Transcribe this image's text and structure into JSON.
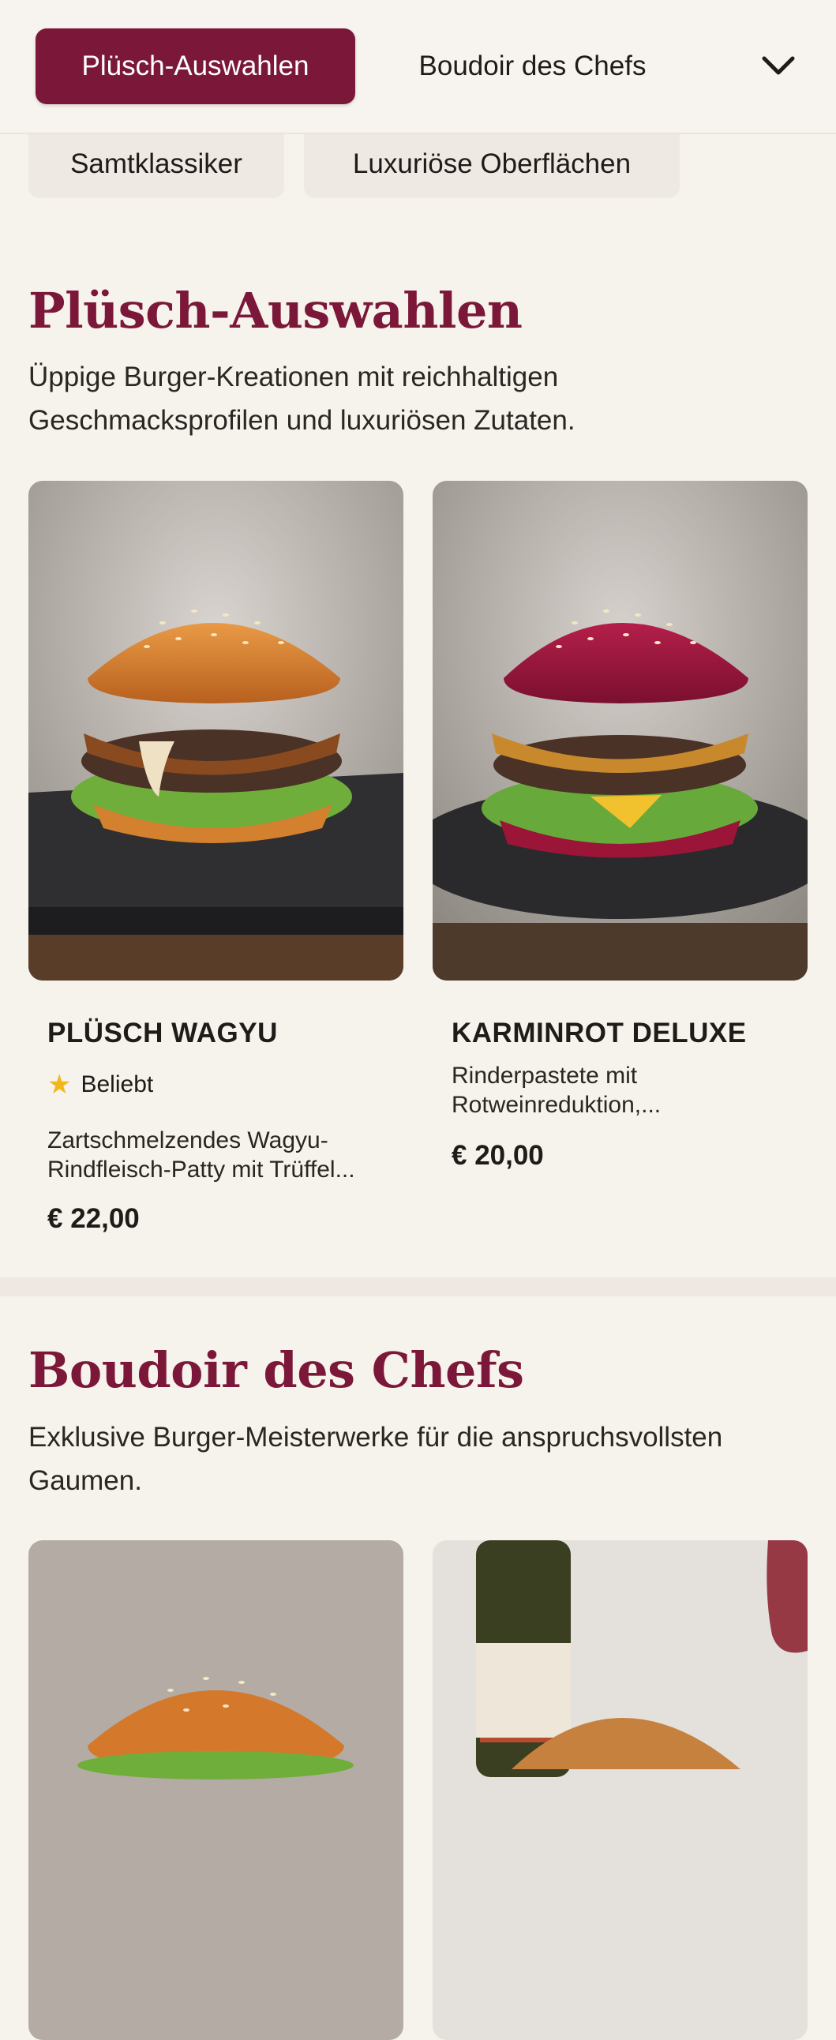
{
  "nav": {
    "categories": [
      {
        "label": "Plüsch-Auswahlen",
        "active": true
      },
      {
        "label": "Boudoir des Chefs",
        "active": false
      }
    ],
    "expand_icon": "chevron-down-icon",
    "subcategories": [
      "Samtklassiker",
      "Luxuriöse Oberflächen"
    ]
  },
  "sections": [
    {
      "title": "Plüsch-Auswahlen",
      "description": "Üppige Burger-Kreationen mit reichhaltigen Geschmacksprofilen und luxuriösen Zutaten.",
      "items": [
        {
          "name": "PLÜSCH WAGYU",
          "badge": "Beliebt",
          "badge_icon": "star-icon",
          "description": "Zartschmelzendes Wagyu-Rindfleisch-Patty mit Trüffel...",
          "price": "€ 22,00"
        },
        {
          "name": "KARMINROT DELUXE",
          "description": "Rinderpastete mit Rotweinreduktion,...",
          "price": "€ 20,00"
        }
      ]
    },
    {
      "title": "Boudoir des Chefs",
      "description": "Exklusive Burger-Meisterwerke für die anspruchsvollsten Gaumen."
    }
  ],
  "colors": {
    "accent": "#7b1839",
    "background": "#f6f2ec",
    "chip": "#efe9e3",
    "star": "#f2b71a"
  }
}
